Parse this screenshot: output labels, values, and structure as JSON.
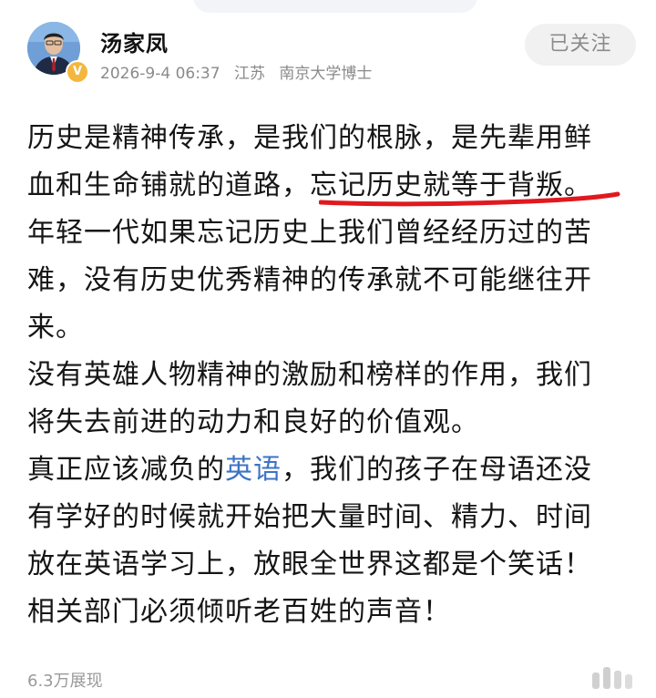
{
  "colors": {
    "accent_link": "#3d73c6",
    "underline_annotation": "#e0191f",
    "verified_badge": "#f4b73e",
    "follow_button_bg": "#f1f1f1"
  },
  "author": {
    "name": "汤家凤",
    "verified_badge_text": "V",
    "post_time": "2026-9-4 06:37",
    "location": "江苏",
    "credential": "南京大学博士"
  },
  "follow_button": {
    "label": "已关注"
  },
  "post": {
    "lines": [
      "历史是精神传承，是我们的根脉，是先辈用鲜",
      "血和生命铺就的道路，",
      "忘记历史就等于背叛。",
      "年轻一代如果忘记历史上我们曾经经历过的苦",
      "难，没有历史优秀精神的传承就不可能继往开",
      "来。",
      "没有英雄人物精神的激励和榜样的作用，我们",
      "将失去前进的动力和良好的价值观。",
      "真正应该减负的",
      "英语",
      "，我们的孩子在母语还没",
      "有学好的时候就开始把大量时间、精力、时间",
      "放在英语学习上，放眼全世界这都是个笑话！",
      "相关部门必须倾听老百姓的声音！"
    ]
  },
  "footer": {
    "views": "6.3万展现",
    "like_icon": "like-icon"
  }
}
